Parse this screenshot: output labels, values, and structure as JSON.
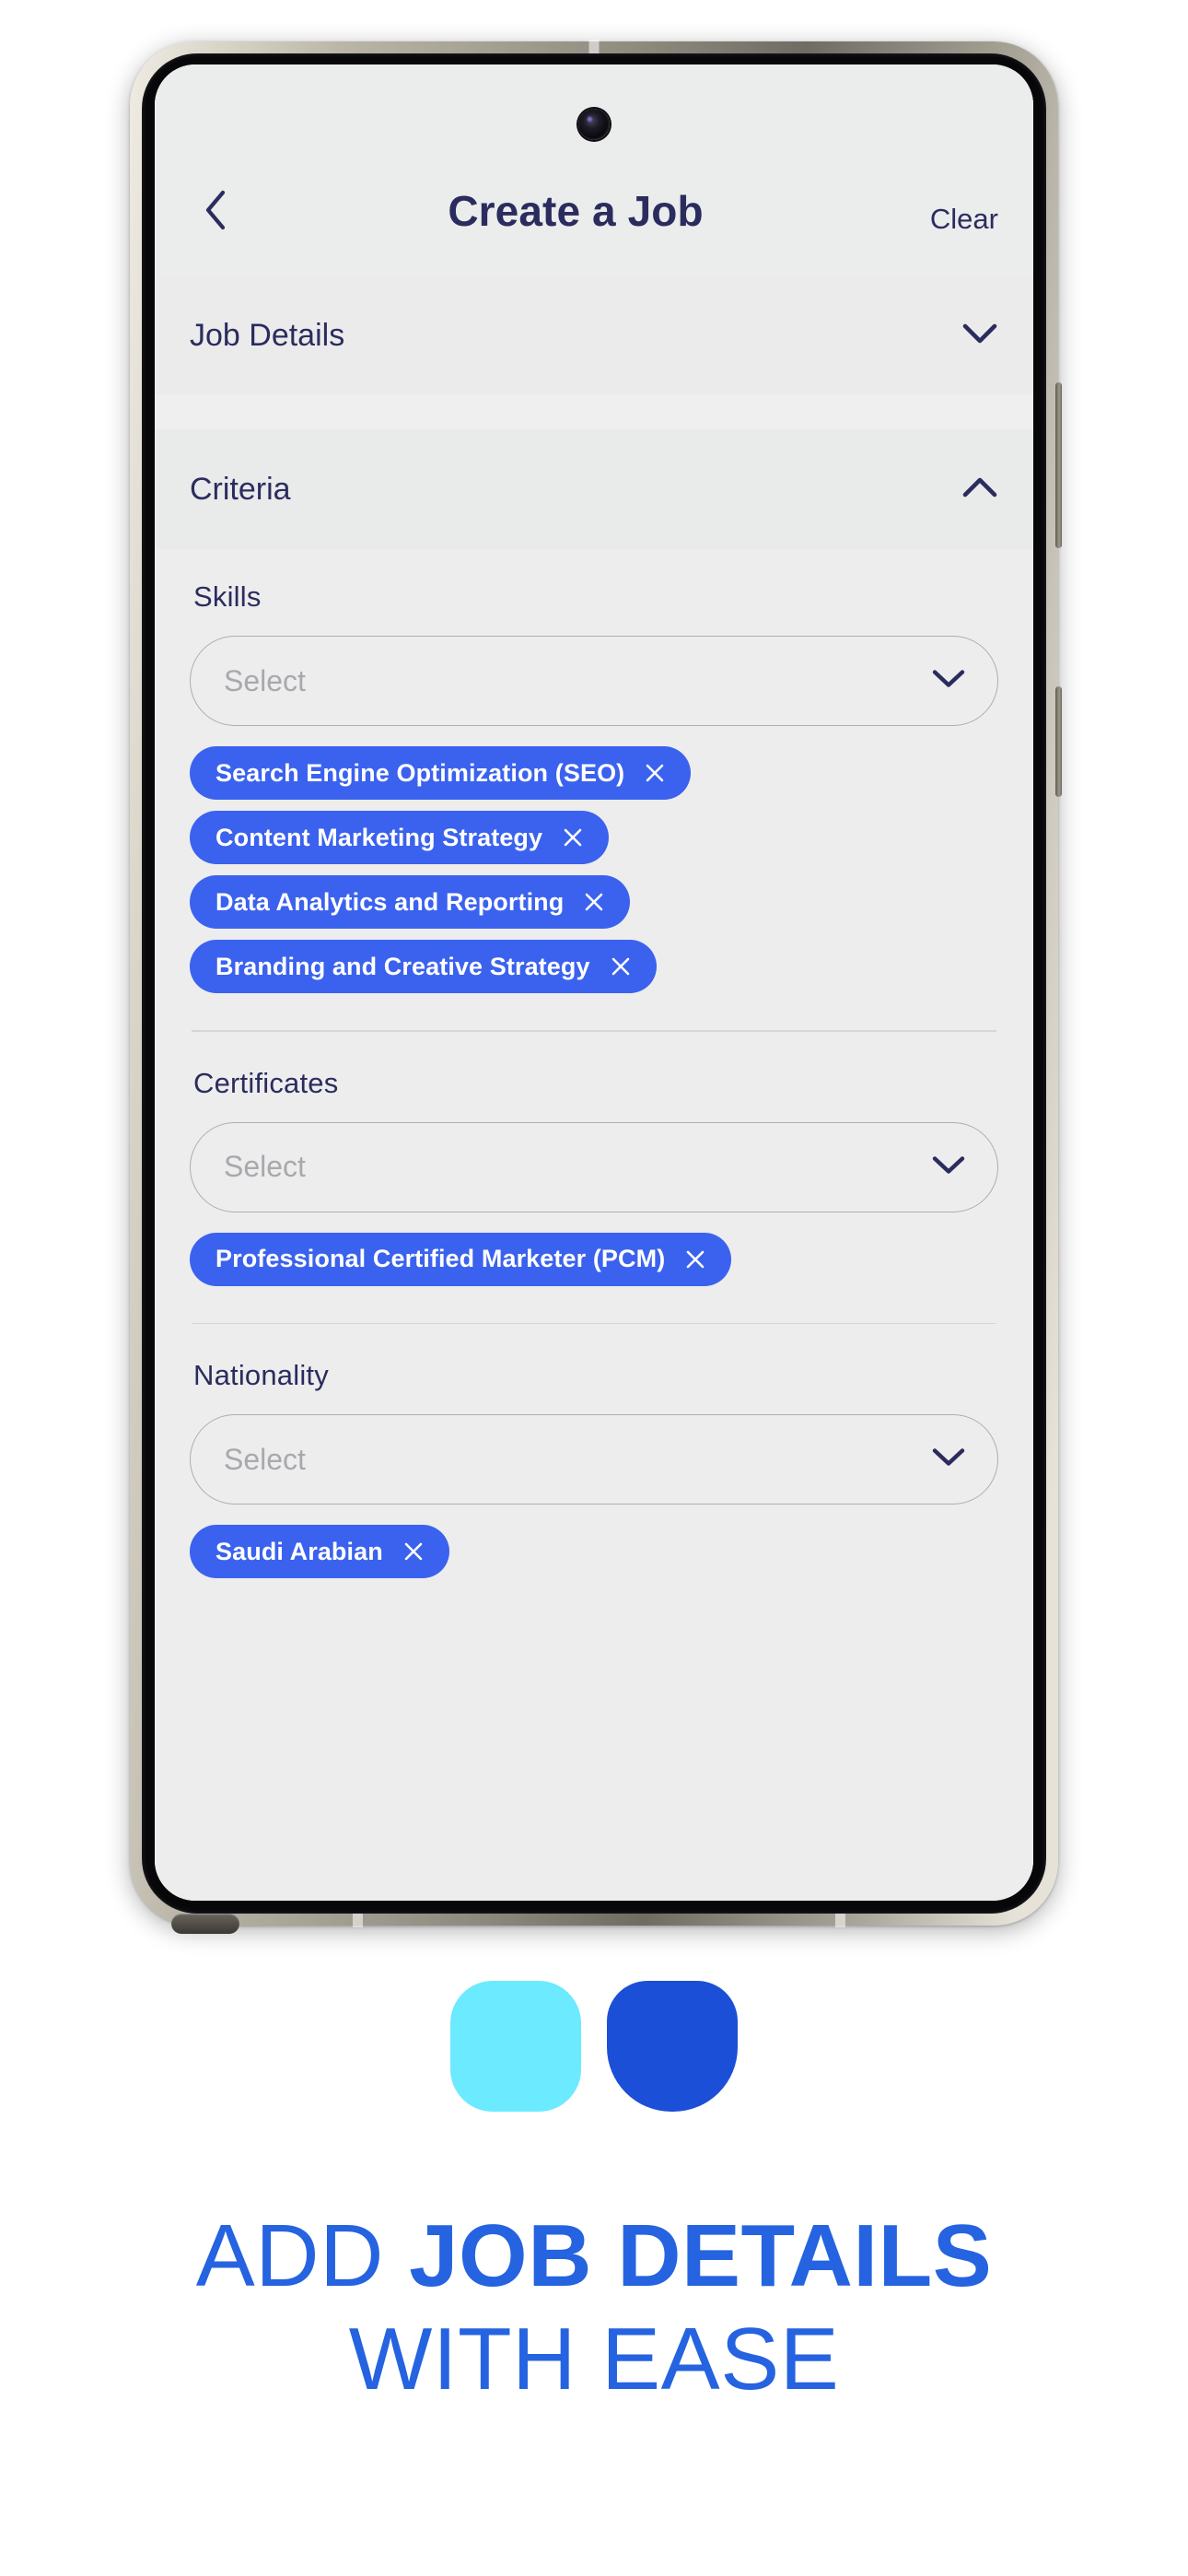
{
  "theme": {
    "accent": "#3b62ee",
    "brand_text": "#2563e0",
    "heading_navy": "#2b2c5e",
    "screen_bg": "#ededed",
    "logo_light": "#6ceaff",
    "logo_dark": "#1c4fd8"
  },
  "appbar": {
    "back_icon": "chevron-left-icon",
    "title": "Create a Job",
    "clear_label": "Clear"
  },
  "sections": [
    {
      "label": "Job Details",
      "expanded": false,
      "chevron": "chevron-down-icon"
    },
    {
      "label": "Criteria",
      "expanded": true,
      "chevron": "chevron-up-icon"
    }
  ],
  "criteria": {
    "skills": {
      "label": "Skills",
      "placeholder": "Select",
      "chevron": "chevron-down-icon",
      "chips": [
        "Search Engine Optimization (SEO)",
        "Content Marketing Strategy",
        "Data Analytics and Reporting",
        "Branding and Creative Strategy"
      ]
    },
    "certificates": {
      "label": "Certificates",
      "placeholder": "Select",
      "chevron": "chevron-down-icon",
      "chips": [
        "Professional Certified Marketer (PCM)"
      ]
    },
    "nationality": {
      "label": "Nationality",
      "placeholder": "Select",
      "chevron": "chevron-down-icon",
      "chips": [
        "Saudi Arabian"
      ]
    }
  },
  "chip_remove_icon": "close-icon",
  "branding": {
    "logo_shape_1": "rounded-square-icon",
    "logo_shape_2": "rounded-shield-icon",
    "tagline_line1_light": "ADD ",
    "tagline_line1_bold": "JOB DETAILS",
    "tagline_line2": "WITH EASE"
  }
}
